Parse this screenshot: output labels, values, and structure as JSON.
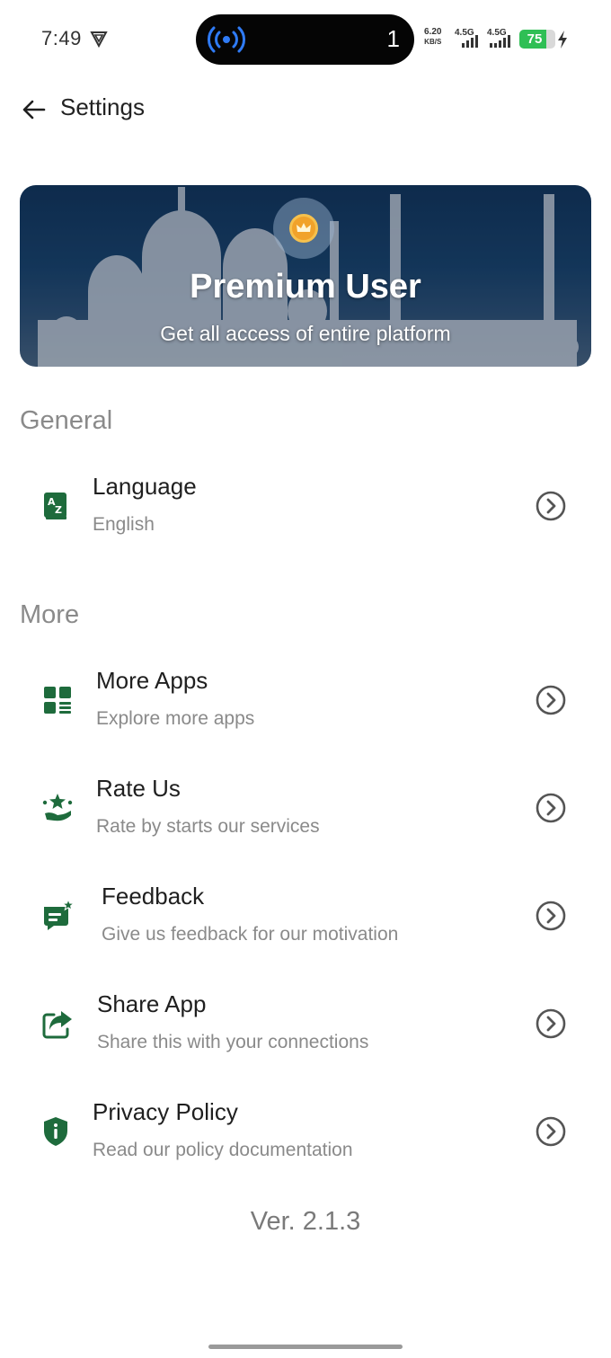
{
  "status_bar": {
    "time": "7:49",
    "island_count": "1",
    "net_speed_value": "6.20",
    "net_speed_unit": "KB/S",
    "signal_1": "4.5G",
    "signal_2": "4.5G",
    "battery": "75",
    "battery_level": 0.75
  },
  "header": {
    "title": "Settings"
  },
  "premium": {
    "title": "Premium User",
    "subtitle": "Get all access of entire platform"
  },
  "sections": {
    "general": {
      "title": "General",
      "items": [
        {
          "title": "Language",
          "subtitle": "English",
          "icon": "translate-icon"
        }
      ]
    },
    "more": {
      "title": "More",
      "items": [
        {
          "title": "More Apps",
          "subtitle": "Explore more apps",
          "icon": "apps-grid-icon"
        },
        {
          "title": "Rate Us",
          "subtitle": "Rate by starts our services",
          "icon": "rate-stars-hand-icon"
        },
        {
          "title": "Feedback",
          "subtitle": "Give us feedback for our motivation",
          "icon": "feedback-chat-icon"
        },
        {
          "title": "Share App",
          "subtitle": "Share this with your connections",
          "icon": "share-icon"
        },
        {
          "title": "Privacy Policy",
          "subtitle": "Read our policy documentation",
          "icon": "shield-info-icon"
        }
      ]
    }
  },
  "version": "Ver. 2.1.3",
  "colors": {
    "accent_green": "#1e6b3c",
    "muted_text": "#8a8a8a",
    "chevron": "#555555",
    "battery_green": "#2fbf55",
    "island_icon_blue": "#2f7bf6"
  }
}
